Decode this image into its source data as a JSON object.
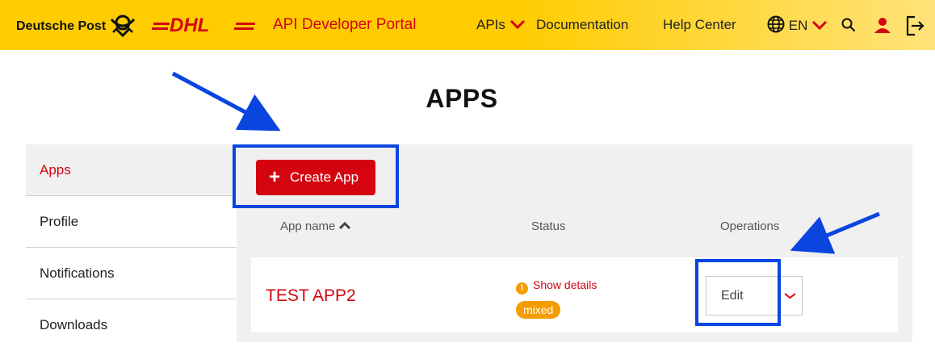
{
  "header": {
    "brand": "Deutsche Post",
    "dhl_logo": "DHL",
    "portal_title": "API Developer Portal",
    "nav": {
      "apis": "APIs",
      "documentation": "Documentation",
      "help_center": "Help Center",
      "language": "EN"
    },
    "icons": [
      "globe-icon",
      "search-icon",
      "user-icon",
      "logout-icon"
    ],
    "colors": {
      "bar": "#ffcc00",
      "accent": "#d40511"
    }
  },
  "page": {
    "title": "APPS"
  },
  "sidebar": {
    "items": [
      {
        "label": "Apps",
        "active": true
      },
      {
        "label": "Profile",
        "active": false
      },
      {
        "label": "Notifications",
        "active": false
      },
      {
        "label": "Downloads",
        "active": false
      }
    ]
  },
  "main": {
    "create_label": "Create App",
    "columns": {
      "app_name": "App name",
      "status": "Status",
      "operations": "Operations"
    },
    "rows": [
      {
        "name": "TEST APP2",
        "status_link": "Show details",
        "status_badge": "mixed",
        "edit_label": "Edit"
      }
    ]
  },
  "annotations": {
    "highlight_color": "#0a45e0"
  }
}
